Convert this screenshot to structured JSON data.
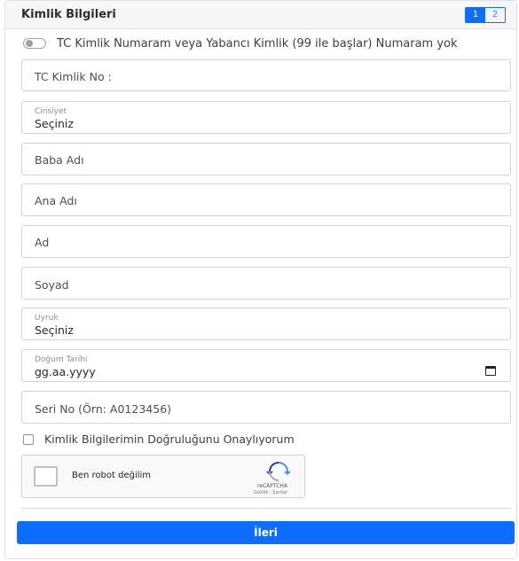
{
  "header": {
    "title": "Kimlik Bilgileri",
    "steps": [
      "1",
      "2"
    ]
  },
  "toggle": {
    "label": "TC Kimlik Numaram veya Yabancı Kimlik (99 ile başlar) Numaram yok",
    "checked": false
  },
  "fields": {
    "tc_no": {
      "placeholder": "TC Kimlik No :"
    },
    "cinsiyet": {
      "label": "Cinsiyet",
      "value": "Seçiniz"
    },
    "baba_adi": {
      "placeholder": "Baba Adı"
    },
    "ana_adi": {
      "placeholder": "Ana Adı"
    },
    "ad": {
      "placeholder": "Ad"
    },
    "soyad": {
      "placeholder": "Soyad"
    },
    "uyruk": {
      "label": "Uyruk",
      "value": "Seçiniz"
    },
    "dogum_tarihi": {
      "label": "Doğum Tarihi",
      "value": "gg.aa.yyyy"
    },
    "seri_no": {
      "placeholder": "Seri No (Örn: A0123456)"
    }
  },
  "confirm": {
    "label": "Kimlik Bilgilerimin Doğruluğunu Onaylıyorum",
    "checked": false
  },
  "captcha": {
    "label": "Ben robot değilim",
    "brand": "reCAPTCHA",
    "terms": "Gizlilik - Şartlar"
  },
  "actions": {
    "next_label": "İleri"
  },
  "colors": {
    "primary": "#0d6efd",
    "border": "#ced4da",
    "header_bg": "#f5f6f8"
  }
}
